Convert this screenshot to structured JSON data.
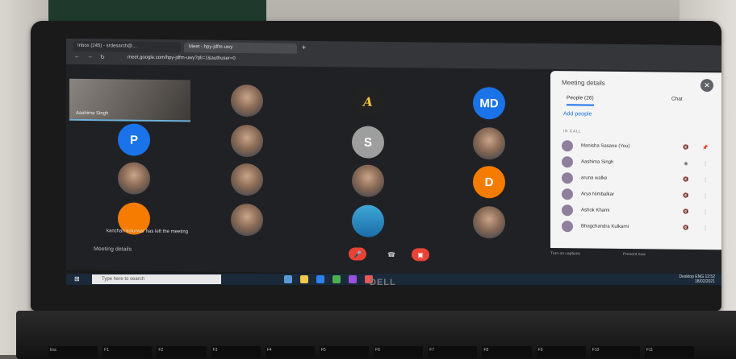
{
  "browser": {
    "tab1_label": "Inbox (245) - srdesarch@...",
    "tab2_label": "Meet - hpy-jdfm-uwy",
    "url": "meet.google.com/hpy-jdfm-uwy?pli=1&authuser=0"
  },
  "meeting": {
    "self_name": "Aashima Singh",
    "toast": "kanchan kolurwar has left the meeting",
    "meeting_details_label": "Meeting details",
    "captions_label": "Turn on captions",
    "present_label": "Present now"
  },
  "tiles": [
    {
      "type": "photo"
    },
    {
      "type": "logo",
      "text": "A"
    },
    {
      "type": "initials",
      "text": "MD",
      "color": "#1a73e8"
    },
    {
      "type": "initials",
      "text": "P",
      "color": "#1a73e8"
    },
    {
      "type": "photo"
    },
    {
      "type": "initials",
      "text": "S",
      "color": "#9e9e9e"
    },
    {
      "type": "photo"
    },
    {
      "type": "photo"
    },
    {
      "type": "photo"
    },
    {
      "type": "photo"
    },
    {
      "type": "initials",
      "text": "D",
      "color": "#f57c00"
    },
    {
      "type": "photo"
    },
    {
      "type": "photo"
    },
    {
      "type": "photo"
    }
  ],
  "panel": {
    "title": "Meeting details",
    "people_tab": "People (26)",
    "chat_tab": "Chat",
    "add_people": "Add people",
    "in_call": "IN CALL",
    "people": [
      {
        "name": "Manisha Sasane (You)"
      },
      {
        "name": "Aashima Singh"
      },
      {
        "name": "aruna walke"
      },
      {
        "name": "Arya Nimbalkar"
      },
      {
        "name": "Ashok Khami"
      },
      {
        "name": "Bhagchandra Kulkarni"
      }
    ]
  },
  "taskbar": {
    "search_placeholder": "Type here to search",
    "desktop": "Desktop",
    "lang": "ENG",
    "time": "12:52",
    "date": "18/02/2021"
  },
  "brand": "DELL",
  "keys": [
    "Esc",
    "F1",
    "F2",
    "F3",
    "F4",
    "F5",
    "F6",
    "F7",
    "F8",
    "F9",
    "F10",
    "F11"
  ]
}
